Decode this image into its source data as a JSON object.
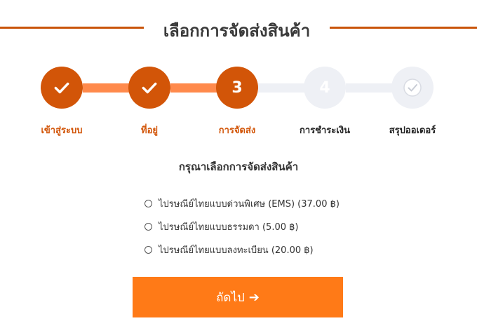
{
  "header": {
    "title": "เลือกการจัดส่งสินค้า"
  },
  "steps": [
    {
      "label": "เข้าสู่ระบบ",
      "state": "done",
      "icon": "check-icon"
    },
    {
      "label": "ที่อยู่",
      "state": "done",
      "icon": "check-icon"
    },
    {
      "label": "การจัดส่ง",
      "state": "active",
      "number": "3"
    },
    {
      "label": "การชำระเงิน",
      "state": "todo",
      "number": "4"
    },
    {
      "label": "สรุปออเดอร์",
      "state": "todo",
      "icon": "check-icon"
    }
  ],
  "shipping": {
    "heading": "กรุณาเลือกการจัดส่งสินค้า",
    "options": [
      {
        "label": "ไปรษณีย์ไทยแบบด่วนพิเศษ (EMS) (37.00 ฿)",
        "selected": false
      },
      {
        "label": "ไปรษณีย์ไทยแบบธรรมดา (5.00 ฿)",
        "selected": false
      },
      {
        "label": "ไปรษณีย์ไทยแบบลงทะเบียน (20.00 ฿)",
        "selected": false
      }
    ]
  },
  "actions": {
    "next_label": "ถัดไป",
    "next_icon": "arrow-right-icon"
  },
  "colors": {
    "accent": "#d25508",
    "progress_done": "#ff8a4c",
    "progress_todo": "#eef0f5",
    "button": "#ff7a17"
  }
}
